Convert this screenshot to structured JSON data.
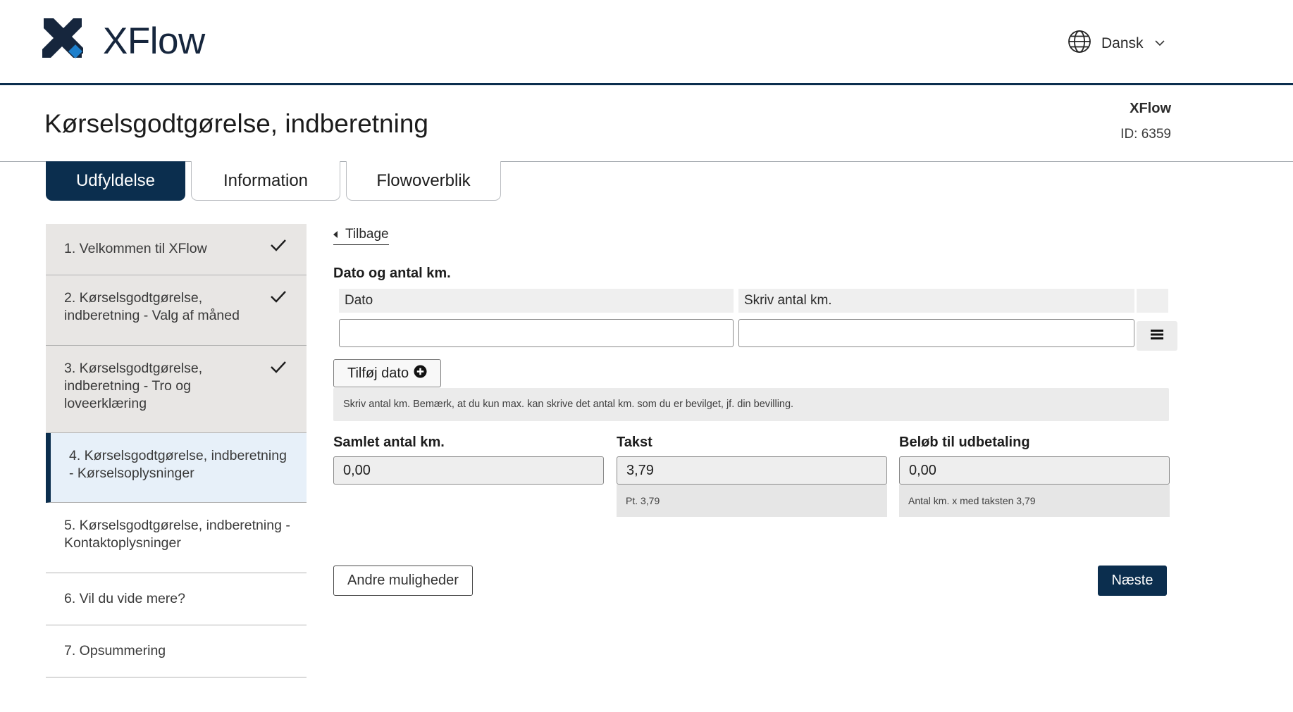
{
  "header": {
    "logo_text": "XFlow",
    "language": "Dansk"
  },
  "title_band": {
    "page_title": "Kørselsgodtgørelse, indberetning",
    "app_name": "XFlow",
    "id_text": "ID: 6359"
  },
  "tabs": [
    {
      "label": "Udfyldelse",
      "active": true
    },
    {
      "label": "Information",
      "active": false
    },
    {
      "label": "Flowoverblik",
      "active": false
    }
  ],
  "steps": [
    {
      "label": "1. Velkommen til XFlow",
      "status": "done"
    },
    {
      "label": "2. Kørselsgodtgørelse, indberetning - Valg af måned",
      "status": "done"
    },
    {
      "label": "3. Kørselsgodtgørelse, indberetning - Tro og loveerklæring",
      "status": "done"
    },
    {
      "label": "4. Kørselsgodtgørelse, indberetning - Kørselsoplysninger",
      "status": "active"
    },
    {
      "label": "5. Kørselsgodtgørelse, indberetning - Kontaktoplysninger",
      "status": "pending"
    },
    {
      "label": "6. Vil du vide mere?",
      "status": "pending"
    },
    {
      "label": "7. Opsummering",
      "status": "pending"
    }
  ],
  "main": {
    "back_label": "Tilbage",
    "section_label": "Dato og antal km.",
    "table": {
      "col_date": "Dato",
      "col_km": "Skriv antal km.",
      "date_value": "",
      "km_value": ""
    },
    "add_date_label": "Tilføj dato",
    "hint": "Skriv antal km. Bemærk, at du kun max. kan skrive det antal km. som du er bevilget, jf. din bevilling.",
    "fields": {
      "total_km": {
        "label": "Samlet antal km.",
        "value": "0,00"
      },
      "rate": {
        "label": "Takst",
        "value": "3,79",
        "help": "Pt. 3,79"
      },
      "payout": {
        "label": "Beløb til udbetaling",
        "value": "0,00",
        "help": "Antal km. x med taksten 3,79"
      }
    },
    "other_options_label": "Andre muligheder",
    "next_label": "Næste"
  },
  "colors": {
    "brand_navy": "#0b2e4e",
    "logo_blue": "#1d7fcb",
    "done_step_bg": "#e8e6e4",
    "active_step_bg": "#e7f0f9"
  },
  "icons": {
    "logo": "xflow-logo-icon",
    "language": "globe-icon",
    "language_toggle": "chevron-down-icon",
    "step_done": "check-icon",
    "back": "caret-left-icon",
    "add": "plus-circle-icon",
    "row_menu": "hamburger-menu-icon"
  }
}
